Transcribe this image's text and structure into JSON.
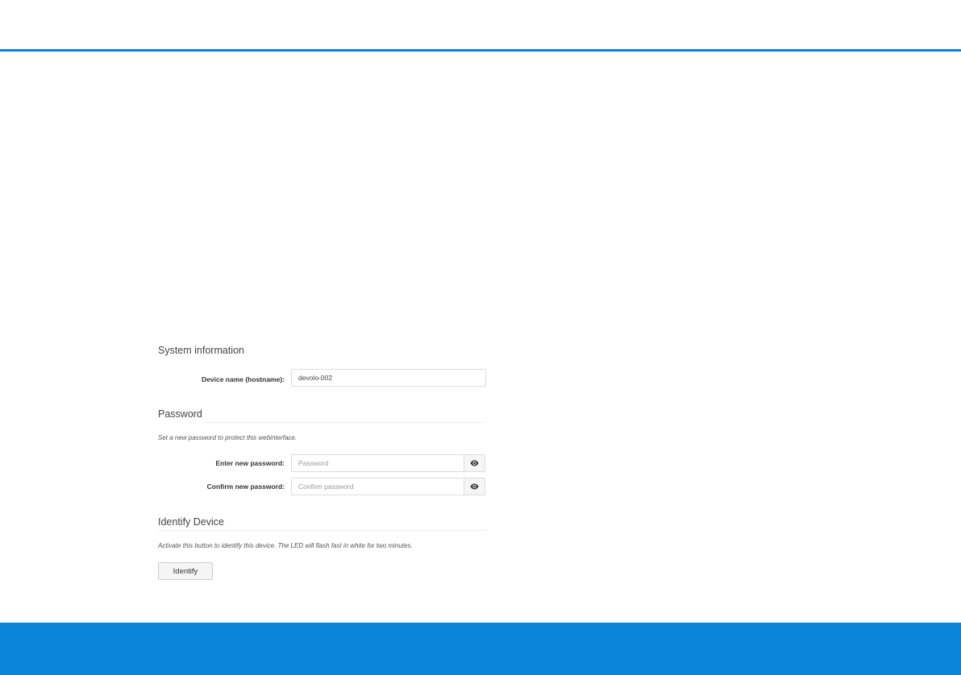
{
  "theme": {
    "accent": "#0a84d9",
    "background": "#ffffff"
  },
  "system_information": {
    "title": "System information",
    "device_name": {
      "label": "Device name (hostname):",
      "value": "devolo-002"
    }
  },
  "password": {
    "title": "Password",
    "hint": "Set a new password to protect this webinterface.",
    "new_password": {
      "label": "Enter new password:",
      "placeholder": "Password",
      "toggle_icon": "eye-icon"
    },
    "confirm_password": {
      "label": "Confirm new password:",
      "placeholder": "Confirm password",
      "toggle_icon": "eye-icon"
    }
  },
  "identify_device": {
    "title": "Identify Device",
    "hint": "Activate this button to identify this device. The LED will flash fast in white for two minutes.",
    "button_label": "Identify"
  }
}
